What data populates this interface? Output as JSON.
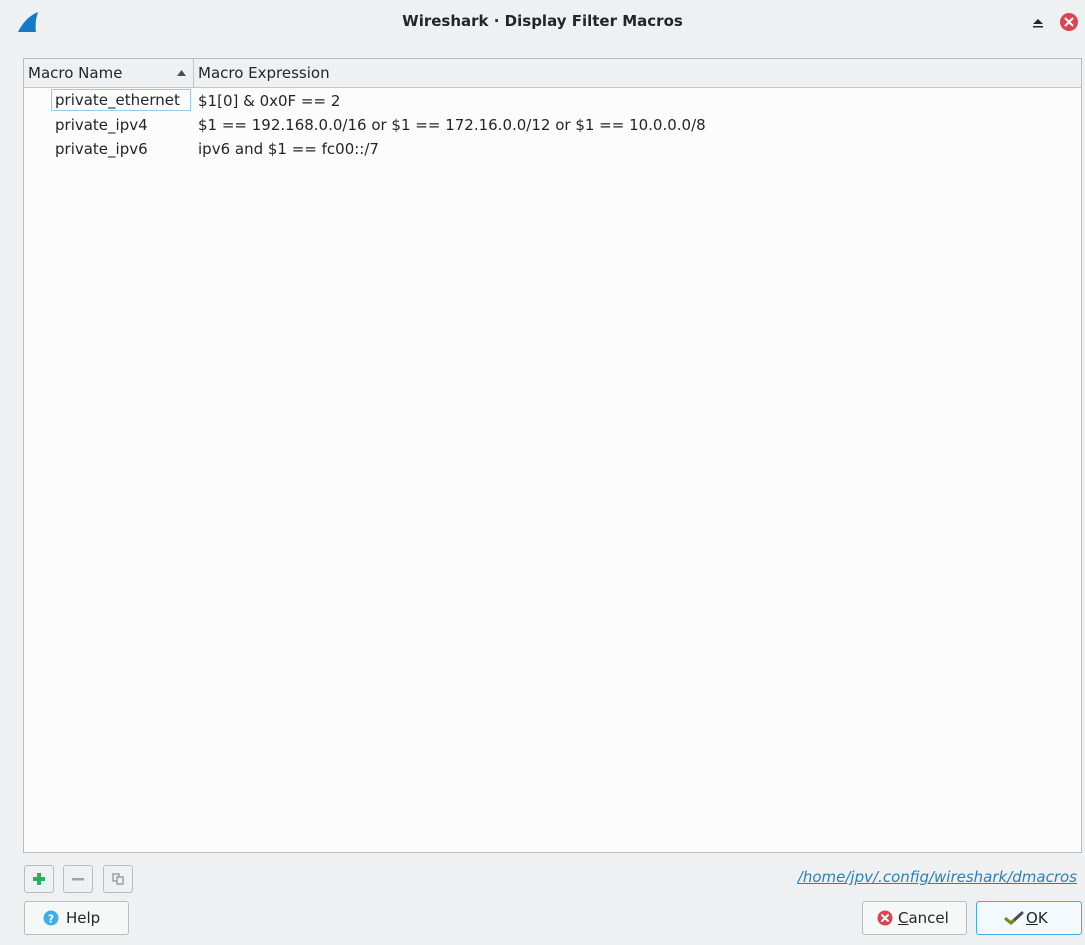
{
  "window": {
    "title": "Wireshark · Display Filter Macros",
    "app_icon": "wireshark-fin-icon",
    "controls": [
      "keep-above-icon",
      "close-icon"
    ]
  },
  "table": {
    "columns": [
      {
        "label": "Macro Name",
        "sort": "ascending"
      },
      {
        "label": "Macro Expression"
      }
    ],
    "rows": [
      {
        "name": "private_ethernet",
        "expression": "$1[0] & 0x0F == 2"
      },
      {
        "name": "private_ipv4",
        "expression": "$1 == 192.168.0.0/16 or $1 == 172.16.0.0/12 or $1 == 10.0.0.0/8"
      },
      {
        "name": "private_ipv6",
        "expression": "ipv6 and $1 == fc00::/7"
      }
    ]
  },
  "toolbar": {
    "add_icon": "plus-icon",
    "remove_icon": "minus-icon",
    "copy_icon": "copy-icon"
  },
  "file_path": "/home/jpv/.config/wireshark/dmacros",
  "buttons": {
    "help": "Help",
    "cancel": "Cancel",
    "ok": "OK"
  },
  "colors": {
    "accent": "#3daee9",
    "link": "#2980b9",
    "close": "#da4453",
    "add": "#27ae60"
  }
}
